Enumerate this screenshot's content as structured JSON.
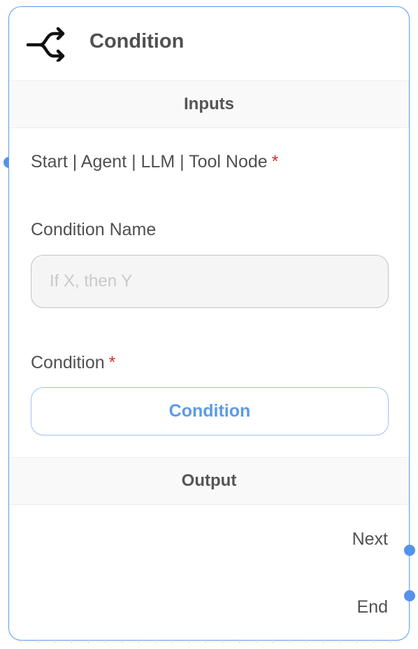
{
  "node": {
    "title": "Condition",
    "icon": "split-arrows-icon"
  },
  "inputs_section": {
    "title": "Inputs",
    "anchor": {
      "label": "Start | Agent | LLM | Tool Node",
      "required_mark": "*"
    },
    "condition_name": {
      "label": "Condition Name",
      "value": "",
      "placeholder": "If X, then Y"
    },
    "condition": {
      "label": "Condition",
      "required_mark": "*",
      "button_label": "Condition"
    }
  },
  "output_section": {
    "title": "Output",
    "outputs": [
      {
        "label": "Next"
      },
      {
        "label": "End"
      }
    ]
  },
  "colors": {
    "accent": "#5b9be8",
    "handle": "#5592ea",
    "required": "#d32f2f",
    "text": "#505050"
  }
}
